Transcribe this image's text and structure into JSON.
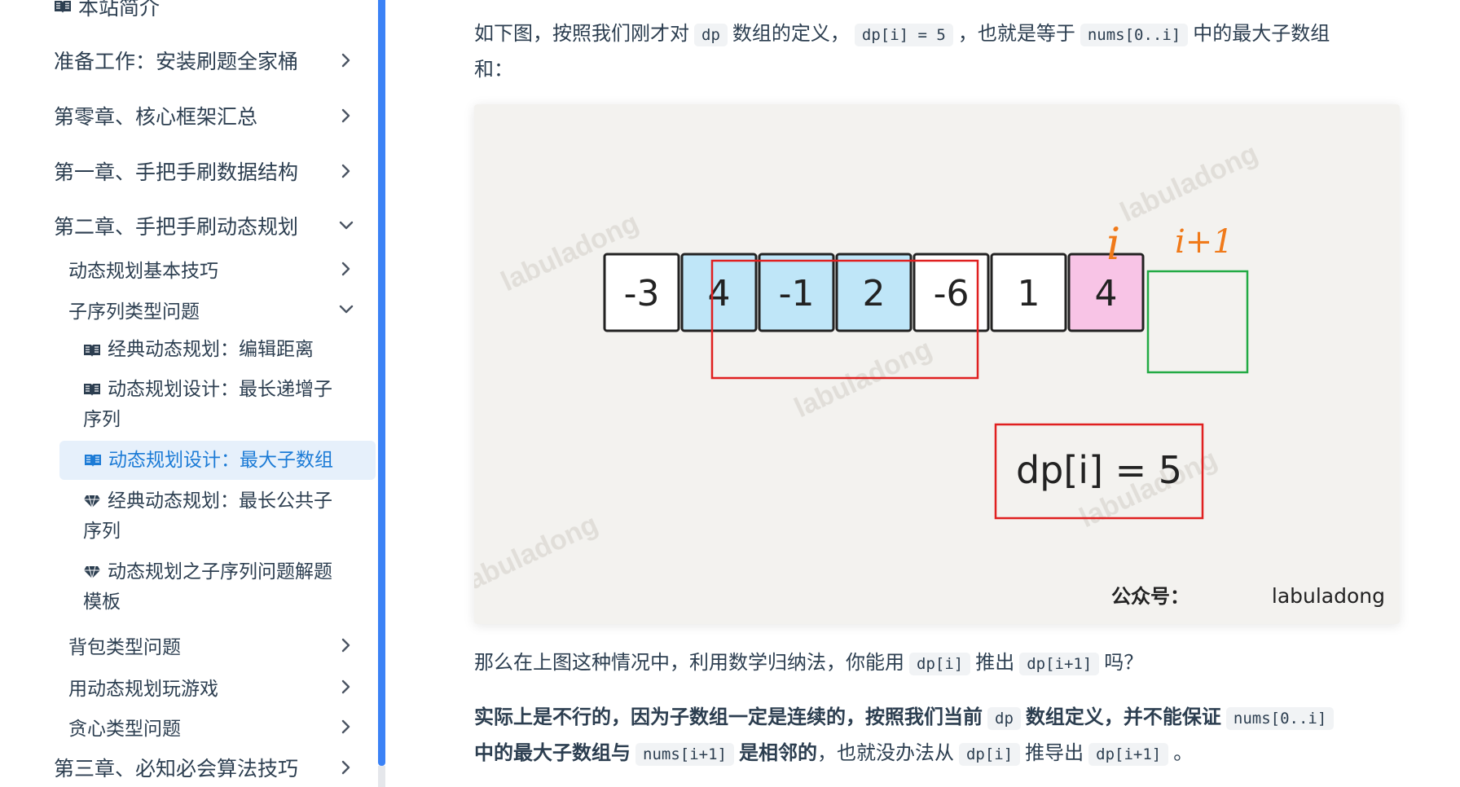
{
  "sidebar": {
    "items": [
      {
        "label": "本站简介",
        "level": 1,
        "icon": "book-icon"
      },
      {
        "label": "准备工作：安装刷题全家桶",
        "level": 1,
        "chevron": "right"
      },
      {
        "label": "第零章、核心框架汇总",
        "level": 1,
        "chevron": "right"
      },
      {
        "label": "第一章、手把手刷数据结构",
        "level": 1,
        "chevron": "right"
      },
      {
        "label": "第二章、手把手刷动态规划",
        "level": 1,
        "chevron": "down"
      },
      {
        "label": "动态规划基本技巧",
        "level": 2,
        "chevron": "right"
      },
      {
        "label": "子序列类型问题",
        "level": 2,
        "chevron": "down"
      },
      {
        "label": "经典动态规划：编辑距离",
        "level": 3,
        "icon": "book-icon"
      },
      {
        "label_line1": "动态规划设计：最长递增子",
        "label_line2": "序列",
        "level": 3,
        "icon": "book-icon"
      },
      {
        "label": "动态规划设计：最大子数组",
        "level": 3,
        "icon": "book-icon",
        "active": true
      },
      {
        "label_line1": "经典动态规划：最长公共子",
        "label_line2": "序列",
        "level": 3,
        "icon": "gem-icon"
      },
      {
        "label_line1": "动态规划之子序列问题解题",
        "label_line2": "模板",
        "level": 3,
        "icon": "gem-icon"
      },
      {
        "label": "背包类型问题",
        "level": 2,
        "chevron": "right"
      },
      {
        "label": "用动态规划玩游戏",
        "level": 2,
        "chevron": "right"
      },
      {
        "label": "贪心类型问题",
        "level": 2,
        "chevron": "right"
      },
      {
        "label": "第三章、必知必会算法技巧",
        "level": 1,
        "chevron": "right"
      }
    ]
  },
  "content": {
    "para1": {
      "t1": "如下图，按照我们刚才对",
      "c1": "dp",
      "t2": "数组的定义，",
      "c2": "dp[i] = 5",
      "t3": "，也就是等于",
      "c3": "nums[0..i]",
      "t4": "中的最大子数组",
      "t5": "和："
    },
    "figure": {
      "array": [
        "-3",
        "4",
        "-1",
        "2",
        "-6",
        "1",
        "4"
      ],
      "label_i": "i",
      "label_i1": "i+1",
      "dp_label": "dp[i] = 5",
      "watermark": "labuladong",
      "credit_prefix": "公众号：",
      "credit": "labuladong",
      "colors": {
        "highlight_blue": "#bfe6f8",
        "highlight_pink": "#f8c4e6",
        "red_box": "#e02020",
        "green_box": "#22aa44",
        "annot_orange": "#f07a1a"
      }
    },
    "para2": {
      "t1": "那么在上图这种情况中，利用数学归纳法，你能用",
      "c1": "dp[i]",
      "t2": "推出",
      "c2": "dp[i+1]",
      "t3": "吗？"
    },
    "para3": {
      "b1": "实际上是不行的，因为子数组一定是连续的，按照我们当前",
      "c1": "dp",
      "b2": "数组定义，并不能保证",
      "c2": "nums[0..i]",
      "b3": "中的最大子数组与",
      "c3": "nums[i+1]",
      "b4": "是相邻的",
      "t1": "，也就没办法从",
      "c4": "dp[i]",
      "t2": "推导出",
      "c5": "dp[i+1]",
      "t3": "。"
    }
  }
}
